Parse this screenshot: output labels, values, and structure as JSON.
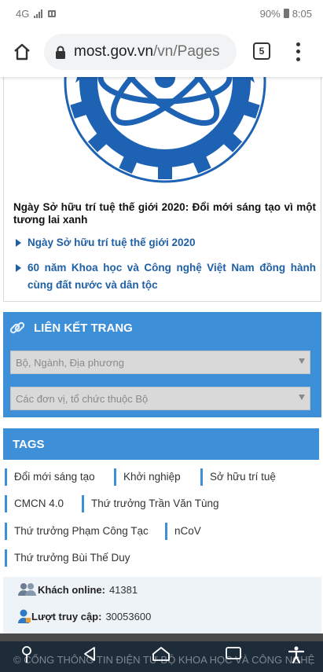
{
  "status_bar": {
    "network": "4G",
    "battery": "90%",
    "time": "8:05"
  },
  "browser": {
    "url_host": "most.gov.vn",
    "url_path": "/vn/Pages",
    "tab_count": "5"
  },
  "news": {
    "title": "Ngày Sở hữu trí tuệ thế giới 2020: Đổi mới sáng tạo vì một tương lai xanh",
    "links": [
      "Ngày Sở hữu trí tuệ thế giới 2020",
      "60 năm Khoa học và Công nghệ Việt Nam đồng hành cùng đất nước và dân tộc"
    ]
  },
  "links_panel": {
    "heading": "LIÊN KẾT TRANG",
    "select_1": "Bộ, Ngành, Địa phương",
    "select_2": "Các đơn vị, tổ chức thuộc Bộ"
  },
  "tags": {
    "heading": "TAGS",
    "items": [
      "Đổi mới sáng tạo",
      "Khởi nghiệp",
      "Sở hữu trí tuệ",
      "CMCN 4.0",
      "Thứ trưởng Trần Văn Tùng",
      "Thứ trưởng Phạm Công Tạc",
      "nCoV",
      "Thứ trưởng Bùi Thế Duy"
    ]
  },
  "stats": {
    "online_label": "Khách online:",
    "online_value": "41381",
    "visits_label": "Lượt truy cập:",
    "visits_value": "30053600"
  },
  "footer": {
    "text": "© CỔNG THÔNG TIN ĐIỆN TỬ BỘ KHOA HỌC VÀ CÔNG NGHỆ"
  },
  "colors": {
    "accent_blue": "#3d8fd8",
    "link_blue": "#1f5fa6",
    "logo_blue": "#1d62b3"
  }
}
